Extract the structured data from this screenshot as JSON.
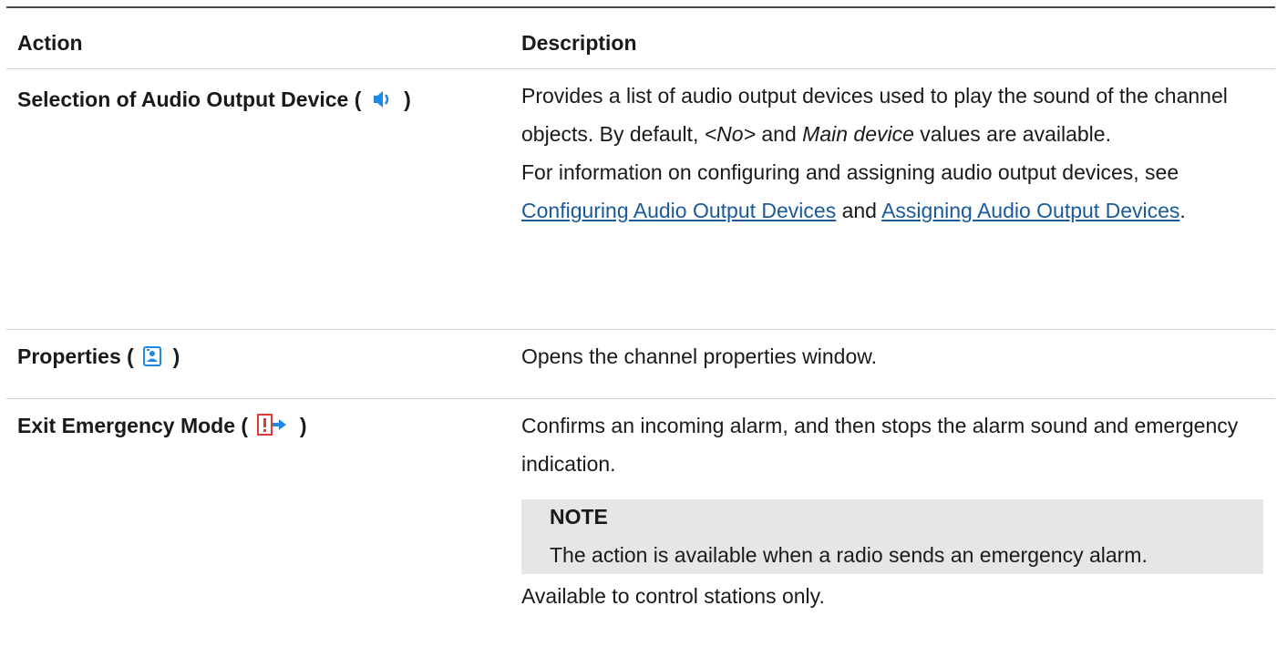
{
  "table": {
    "headers": {
      "action": "Action",
      "description": "Description"
    },
    "rows": [
      {
        "action_prefix": "Selection of Audio Output Device (",
        "action_suffix": ")",
        "icon": "speaker-icon",
        "desc_line1_pre": "Provides a list of audio output devices used to play the sound of the channel objects. By default, ",
        "desc_no": "<No>",
        "desc_and": " and ",
        "desc_main": "Main device",
        "desc_line1_post": " values are available.",
        "desc_line2_pre": "For information on configuring and assigning audio output devices, see ",
        "link1": "Configuring Audio Output Devices",
        "desc_line2_mid": " and ",
        "link2": "Assigning Audio Output Devices",
        "desc_line2_post": "."
      },
      {
        "action_prefix": "Properties (",
        "action_suffix": ")",
        "icon": "properties-icon",
        "description": "Opens the channel properties window."
      },
      {
        "action_prefix": "Exit Emergency Mode (",
        "action_suffix": ")",
        "icon": "exit-emergency-icon",
        "description": "Confirms an incoming alarm, and then stops the alarm sound and emergency indication.",
        "note_title": "NOTE",
        "note_text": "The action is available when a radio sends an emergency alarm.",
        "footer": "Available to control stations only."
      }
    ]
  },
  "colors": {
    "link": "#1a5a9a",
    "note_bg": "#e6e6e6",
    "icon_blue": "#1e88e5",
    "icon_red": "#e53935"
  }
}
